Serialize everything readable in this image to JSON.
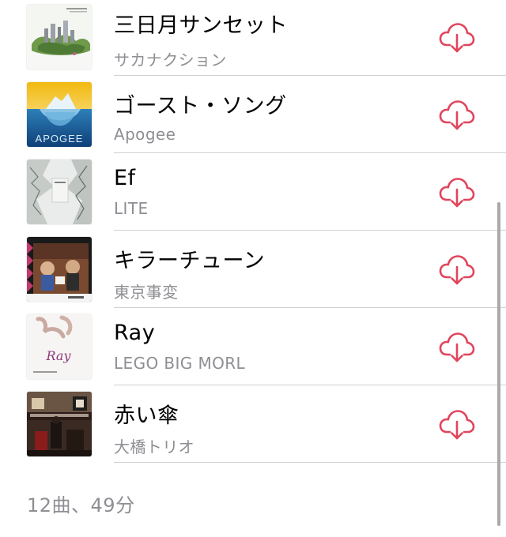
{
  "accent_color": "#e0455c",
  "songs": [
    {
      "title": "三日月サンセット",
      "artist": "サカナクション",
      "download_icon": "cloud-download-icon"
    },
    {
      "title": "ゴースト・ソング",
      "artist": "Apogee",
      "artwork_text": "APOGEE",
      "download_icon": "cloud-download-icon"
    },
    {
      "title": "Ef",
      "artist": "LITE",
      "download_icon": "cloud-download-icon"
    },
    {
      "title": "キラーチューン",
      "artist": "東京事変",
      "download_icon": "cloud-download-icon"
    },
    {
      "title": "Ray",
      "artist": "LEGO BIG MORL",
      "artwork_text": "Ray",
      "download_icon": "cloud-download-icon"
    },
    {
      "title": "赤い傘",
      "artist": "大橋トリオ",
      "download_icon": "cloud-download-icon"
    }
  ],
  "footer": {
    "summary": "12曲、49分"
  }
}
